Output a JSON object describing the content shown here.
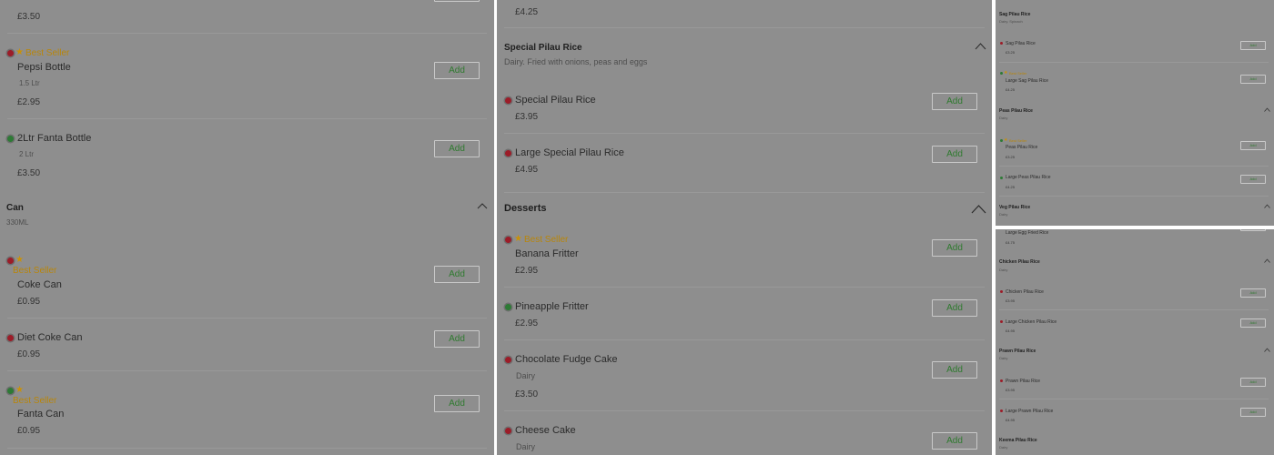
{
  "panel1": {
    "top_price": "£3.50",
    "pepsi": {
      "badge": "Best Seller",
      "name": "Pepsi Bottle",
      "desc": "1.5 Ltr",
      "price": "£2.95",
      "add": "Add"
    },
    "fanta_bottle": {
      "name": "2Ltr Fanta Bottle",
      "desc": "2 Ltr",
      "price": "£3.50",
      "add": "Add"
    },
    "can_section": {
      "title": "Can",
      "desc": "330ML"
    },
    "coke_can": {
      "badge": "Best Seller",
      "name": "Coke Can",
      "price": "£0.95",
      "add": "Add"
    },
    "diet_coke": {
      "name": "Diet Coke Can",
      "price": "£0.95",
      "add": "Add"
    },
    "fanta_can": {
      "badge": "Best Seller",
      "name": "Fanta Can",
      "price": "£0.95",
      "add": "Add"
    }
  },
  "panel2": {
    "top_price": "£4.25",
    "special_section": {
      "title": "Special Pilau Rice",
      "desc": "Dairy. Fried with onions, peas and eggs"
    },
    "special": {
      "name": "Special Pilau Rice",
      "price": "£3.95",
      "add": "Add"
    },
    "large_special": {
      "name": "Large Special Pilau Rice",
      "price": "£4.95",
      "add": "Add"
    },
    "desserts_section": {
      "title": "Desserts"
    },
    "banana": {
      "badge": "Best Seller",
      "name": "Banana Fritter",
      "price": "£2.95",
      "add": "Add"
    },
    "pineapple": {
      "name": "Pineapple Fritter",
      "price": "£2.95",
      "add": "Add"
    },
    "fudge": {
      "name": "Chocolate Fudge Cake",
      "desc": "Dairy",
      "price": "£3.50",
      "add": "Add"
    },
    "cheese": {
      "name": "Cheese Cake",
      "desc": "Dairy",
      "add": "Add"
    }
  },
  "panel3": {
    "sag_section": {
      "title": "Sag Pilau Rice",
      "desc": "Dairy. Spinach"
    },
    "sag": {
      "name": "Sag Pilau Rice",
      "price": "£3.25",
      "add": "Add"
    },
    "large_sag": {
      "badge": "Best Seller",
      "name": "Large Sag Pilau Rice",
      "price": "£4.25",
      "add": "Add"
    },
    "peas_section": {
      "title": "Peas Pilau Rice",
      "desc": "Dairy"
    },
    "peas": {
      "badge": "Best Seller",
      "name": "Peas Pilau Rice",
      "price": "£3.25",
      "add": "Add"
    },
    "large_peas": {
      "name": "Large Peas Pilau Rice",
      "price": "£4.25",
      "add": "Add"
    },
    "veg_section": {
      "title": "Veg Pilau Rice",
      "desc": "Dairy"
    }
  },
  "panel4": {
    "egg": {
      "name": "Large Egg Fried Rice",
      "price": "£4.75"
    },
    "chicken_section": {
      "title": "Chicken Pilau Rice",
      "desc": "Dairy"
    },
    "chicken": {
      "name": "Chicken Pilau Rice",
      "price": "£3.95",
      "add": "Add"
    },
    "large_chicken": {
      "name": "Large Chicken Pilau Rice",
      "price": "£4.95",
      "add": "Add"
    },
    "prawn_section": {
      "title": "Prawn Pilau Rice",
      "desc": "Dairy"
    },
    "prawn": {
      "name": "Prawn Pilau Rice",
      "price": "£3.95",
      "add": "Add"
    },
    "large_prawn": {
      "name": "Large Prawn Pilau Rice",
      "price": "£4.95",
      "add": "Add"
    },
    "keema_section": {
      "title": "Keema Pilau Rice",
      "desc": "Dairy"
    }
  },
  "colors": {
    "overlay": "#8e8e8e",
    "add_text": "#2f7a2f",
    "best_seller": "#b8860b",
    "non_veg_dot": "#9c1c28",
    "veg_dot": "#2d7a35"
  }
}
